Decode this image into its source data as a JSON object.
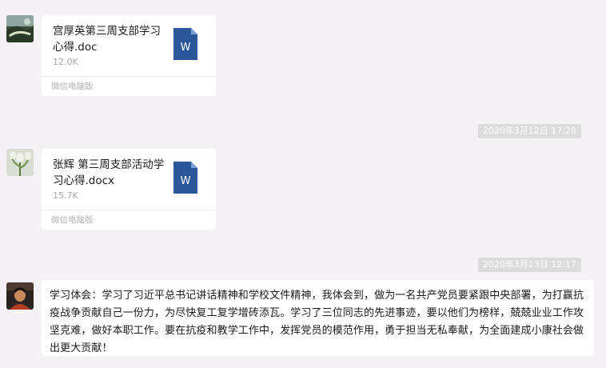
{
  "messages": [
    {
      "type": "file",
      "avatar": "landscape-avatar",
      "file_name": "宫厚英第三周支部学习心得.doc",
      "file_size": "12.0K",
      "source": "微信电脑版",
      "file_icon": "word-doc-icon",
      "icon_letter": "W"
    },
    {
      "type": "timestamp",
      "text": "2020年3月12日 17:28"
    },
    {
      "type": "file",
      "avatar": "flower-avatar",
      "file_name": "张辉 第三周支部活动学习心得.docx",
      "file_size": "15.7K",
      "source": "微信电脑版",
      "file_icon": "word-doc-icon",
      "icon_letter": "W"
    },
    {
      "type": "timestamp",
      "text": "2020年3月13日 12:17"
    },
    {
      "type": "text",
      "avatar": "portrait-avatar",
      "text": "学习体会：学习了习近平总书记讲话精神和学校文件精神，我体会到，做为一名共产党员要紧跟中央部署，为打赢抗疫战争贡献自己一份力，为尽快复工复学增砖添瓦。学习了三位同志的先进事迹，要以他们为榜样，兢兢业业工作攻坚克难，做好本职工作。要在抗疫和教学工作中，发挥党员的模范作用，勇于担当无私奉献，为全面建成小康社会做出更大贡献！"
    }
  ],
  "colors": {
    "background": "#f5f2f6",
    "bubble": "#ffffff",
    "timestamp_bg": "#dcdcdc",
    "word_blue": "#2b579a"
  }
}
